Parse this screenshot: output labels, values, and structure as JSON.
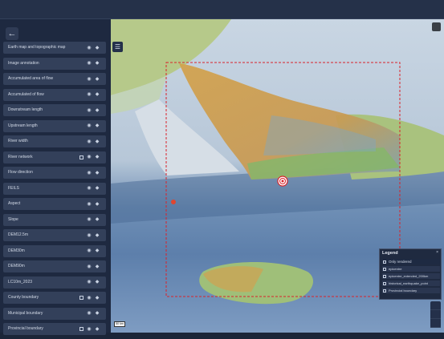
{
  "sidebar": {
    "back_icon": "arrow-left-icon",
    "items": [
      {
        "label": "Earth map and topographic map",
        "icons": [
          "eye-icon",
          "location-icon"
        ]
      },
      {
        "label": "Image annotation",
        "icons": [
          "eye-icon",
          "location-icon"
        ]
      },
      {
        "label": "Accumulated area of flow",
        "icons": [
          "eye-icon",
          "location-icon"
        ]
      },
      {
        "label": "Accumulated of flow",
        "icons": [
          "eye-icon",
          "location-icon"
        ]
      },
      {
        "label": "Downstream length",
        "icons": [
          "eye-icon",
          "location-icon"
        ]
      },
      {
        "label": "Upstream length",
        "icons": [
          "eye-icon",
          "location-icon"
        ]
      },
      {
        "label": "River width",
        "icons": [
          "eye-icon",
          "location-icon"
        ]
      },
      {
        "label": "River network",
        "icons": [
          "table-icon",
          "eye-icon",
          "location-icon"
        ]
      },
      {
        "label": "Flow direction",
        "icons": [
          "eye-icon",
          "location-icon"
        ]
      },
      {
        "label": "FEILS",
        "icons": [
          "eye-icon",
          "location-icon"
        ]
      },
      {
        "label": "Aspect",
        "icons": [
          "eye-icon",
          "location-icon"
        ]
      },
      {
        "label": "Slope",
        "icons": [
          "eye-icon",
          "location-icon"
        ]
      },
      {
        "label": "DEM12.5m",
        "icons": [
          "eye-icon",
          "location-icon"
        ]
      },
      {
        "label": "DEM30m",
        "icons": [
          "eye-icon",
          "location-icon"
        ]
      },
      {
        "label": "DEM90m",
        "icons": [
          "eye-icon",
          "location-icon"
        ]
      },
      {
        "label": "LC10m_2023",
        "icons": [
          "eye-icon",
          "location-icon"
        ]
      },
      {
        "label": "County boundary",
        "icons": [
          "table-icon",
          "eye-icon",
          "location-icon"
        ]
      },
      {
        "label": "Municipal boundary",
        "icons": [
          "eye-icon",
          "location-icon"
        ]
      },
      {
        "label": "Provincial boundary",
        "icons": [
          "table-icon",
          "eye-icon",
          "location-icon"
        ]
      }
    ]
  },
  "map": {
    "layers_icon": "list-icon",
    "scale_label": "50 km",
    "extent_color": "#d9232a",
    "marker_icon": "target-marker-icon",
    "earthquake_icon": "earthquake-point-icon"
  },
  "legend": {
    "title": "Legend",
    "close_icon": "close-icon",
    "only_rendered": "Only rendered",
    "items": [
      "epicentre",
      "epicentre_extended_200km",
      "historical_earthquake_point",
      "Provincial boundary"
    ]
  }
}
